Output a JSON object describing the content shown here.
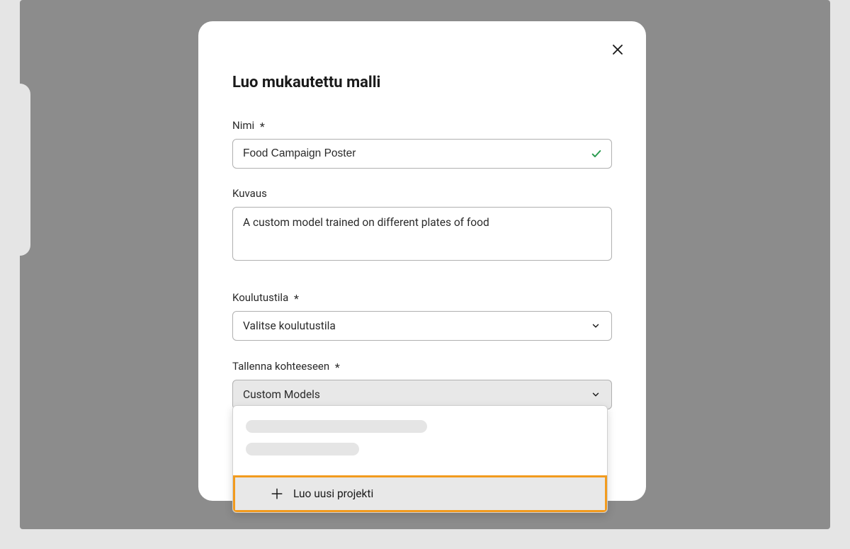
{
  "modal": {
    "title": "Luo mukautettu malli",
    "fields": {
      "name": {
        "label": "Nimi",
        "required": true,
        "value": "Food Campaign Poster",
        "valid": true
      },
      "description": {
        "label": "Kuvaus",
        "required": false,
        "value": "A custom model trained on different plates of food"
      },
      "trainingMode": {
        "label": "Koulutustila",
        "required": true,
        "placeholder": "Valitse koulutustila",
        "value": ""
      },
      "saveTo": {
        "label": "Tallenna kohteeseen",
        "required": true,
        "value": "Custom Models"
      }
    },
    "dropdown": {
      "createNew": "Luo uusi projekti"
    }
  }
}
